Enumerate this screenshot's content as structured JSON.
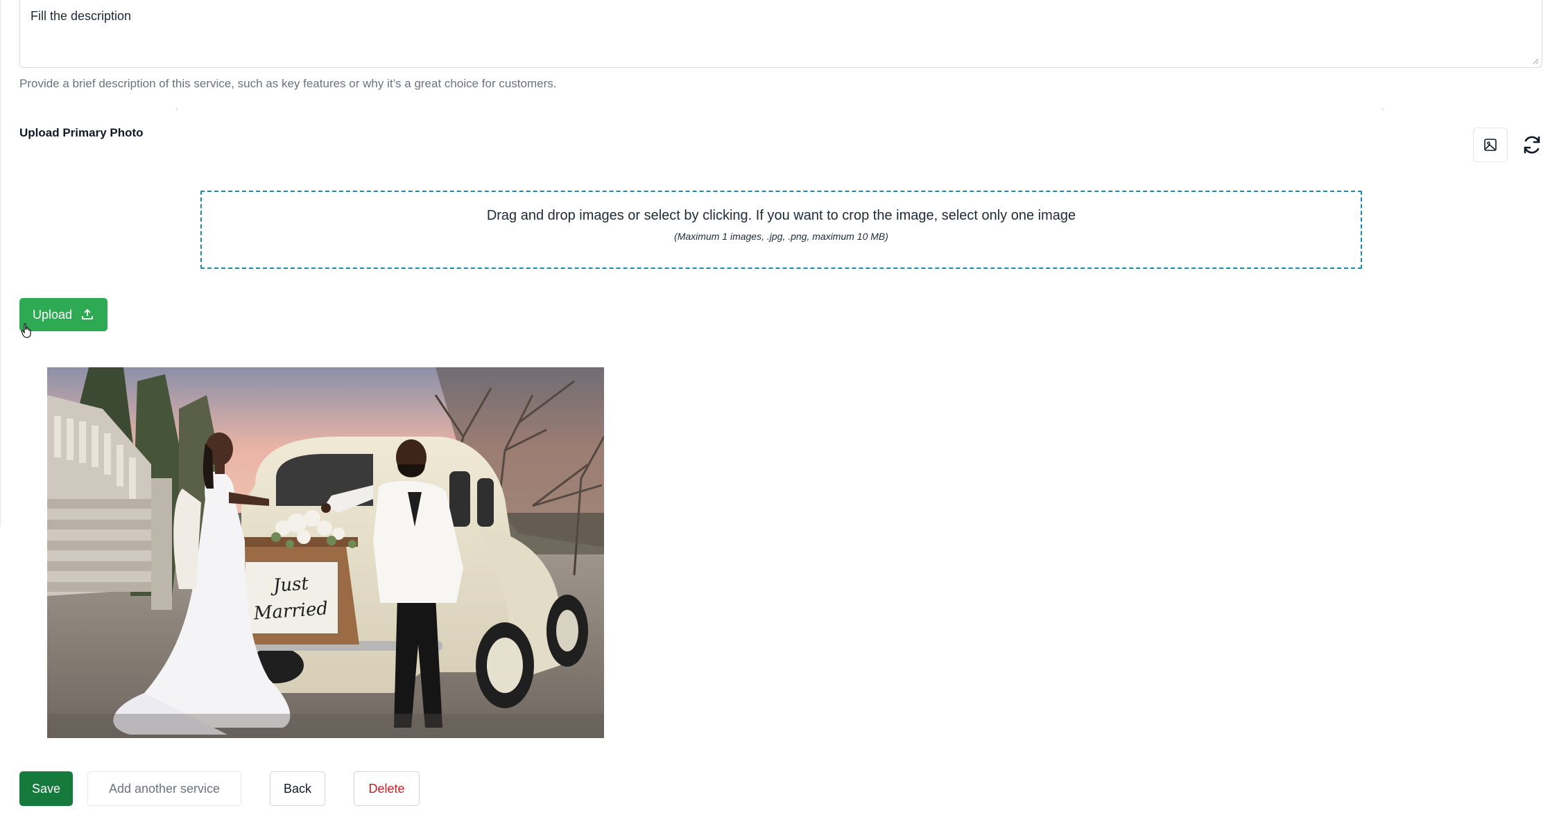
{
  "description": {
    "value": "Fill the description",
    "hint": "Provide a brief description of this service, such as key features or why it’s a great choice for customers."
  },
  "photo_section": {
    "label": "Upload Primary Photo",
    "image_icon": "image-icon",
    "refresh_icon": "refresh-icon"
  },
  "dropzone": {
    "main_text": "Drag and drop images or select by clicking. If you want to crop the image, select only one image",
    "sub_text": "(Maximum 1 images, .jpg, .png, maximum 10 MB)"
  },
  "upload": {
    "label": "Upload",
    "icon": "upload-icon",
    "color": "#2eaa55"
  },
  "preview": {
    "sign_line1": "Just",
    "sign_line2": "Married"
  },
  "actions": {
    "save": "Save",
    "add_another": "Add another service",
    "back": "Back",
    "delete": "Delete"
  },
  "colors": {
    "save_bg": "#157a3b",
    "delete_text": "#c81e1e",
    "dropzone_border": "#1a8aa6"
  }
}
